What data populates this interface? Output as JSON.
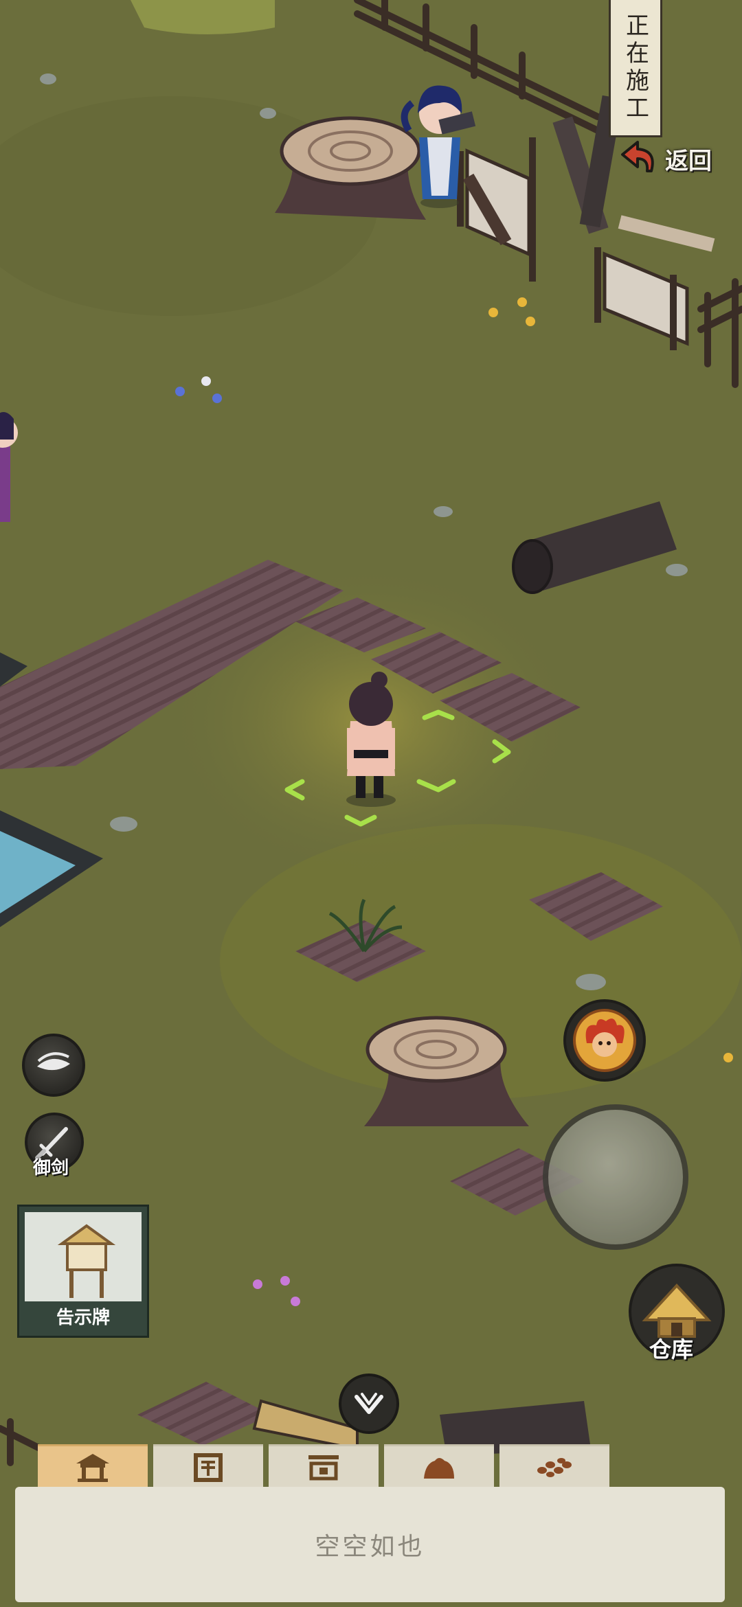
{
  "top_banner": {
    "label": "正在施工"
  },
  "back_button": {
    "label": "返回"
  },
  "left_tools": {
    "hide_button_icon": "eye-icon",
    "sword_flight": {
      "label": "御剑",
      "icon": "sword-icon"
    }
  },
  "notice_board": {
    "label": "告示牌",
    "icon": "notice-board-icon"
  },
  "skill_button": {
    "icon": "flame-portrait-icon"
  },
  "joystick": {
    "icon": "joystick"
  },
  "warehouse": {
    "label": "仓库",
    "icon": "straw-hut-icon"
  },
  "collapse_button": {
    "icon": "chevron-down-icon"
  },
  "build_tabs": [
    {
      "icon": "pavilion-icon",
      "active": true
    },
    {
      "icon": "window-frame-icon",
      "active": false
    },
    {
      "icon": "gate-icon",
      "active": false
    },
    {
      "icon": "rock-icon",
      "active": false
    },
    {
      "icon": "pebbles-icon",
      "active": false
    }
  ],
  "panel": {
    "empty_text": "空空如也"
  },
  "colors": {
    "ground": "#6b6e3c",
    "tab_active": "#e9c48a",
    "panel": "#e6e3d6",
    "selection": "#a8e04a"
  }
}
